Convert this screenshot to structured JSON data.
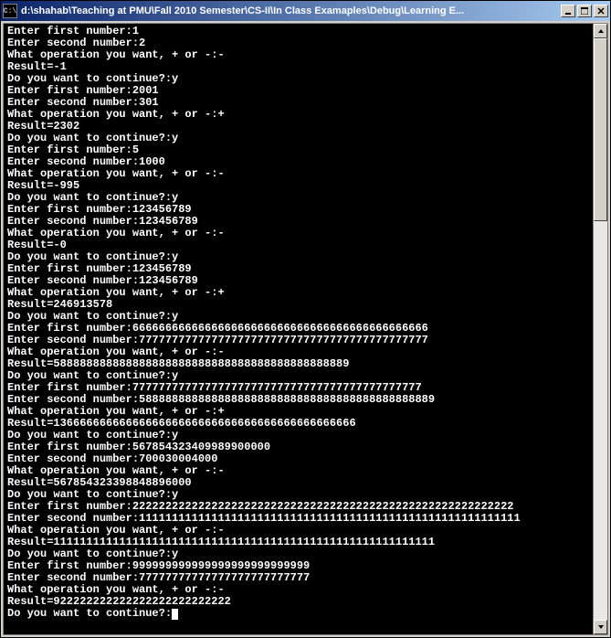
{
  "window": {
    "icon_label": "C:\\",
    "title": "d:\\shahab\\Teaching at PMU\\Fall 2010 Semester\\CS-II\\In Class Examaples\\Debug\\Learning E..."
  },
  "console": {
    "lines": [
      "Enter first number:1",
      "Enter second number:2",
      "What operation you want, + or -:-",
      "Result=-1",
      "Do you want to continue?:y",
      "Enter first number:2001",
      "Enter second number:301",
      "What operation you want, + or -:+",
      "Result=2302",
      "Do you want to continue?:y",
      "Enter first number:5",
      "Enter second number:1000",
      "What operation you want, + or -:-",
      "Result=-995",
      "Do you want to continue?:y",
      "Enter first number:123456789",
      "Enter second number:123456789",
      "What operation you want, + or -:-",
      "Result=-0",
      "Do you want to continue?:y",
      "Enter first number:123456789",
      "Enter second number:123456789",
      "What operation you want, + or -:+",
      "Result=246913578",
      "Do you want to continue?:y",
      "Enter first number:666666666666666666666666666666666666666666666",
      "Enter second number:77777777777777777777777777777777777777777777",
      "What operation you want, + or -:-",
      "Result=588888888888888888888888888888888888888888889",
      "Do you want to continue?:y",
      "Enter first number:77777777777777777777777777777777777777777777",
      "Enter second number:588888888888888888888888888888888888888888889",
      "What operation you want, + or -:+",
      "Result=1366666666666666666666666666666666666666666666",
      "Do you want to continue?:y",
      "Enter first number:567854323409989900000",
      "Enter second number:700030004000",
      "What operation you want, + or -:-",
      "Result=567854323398848896000",
      "Do you want to continue?:y",
      "Enter first number:2222222222222222222222222222222222222222222222222222222222",
      "Enter second number:1111111111111111111111111111111111111111111111111111111111",
      "What operation you want, + or -:-",
      "Result=1111111111111111111111111111111111111111111111111111111111",
      "Do you want to continue?:y",
      "Enter first number:999999999999999999999999999",
      "Enter second number:77777777777777777777777777",
      "What operation you want, + or -:-",
      "Result=922222222222222222222222222",
      "Do you want to continue?:"
    ]
  }
}
